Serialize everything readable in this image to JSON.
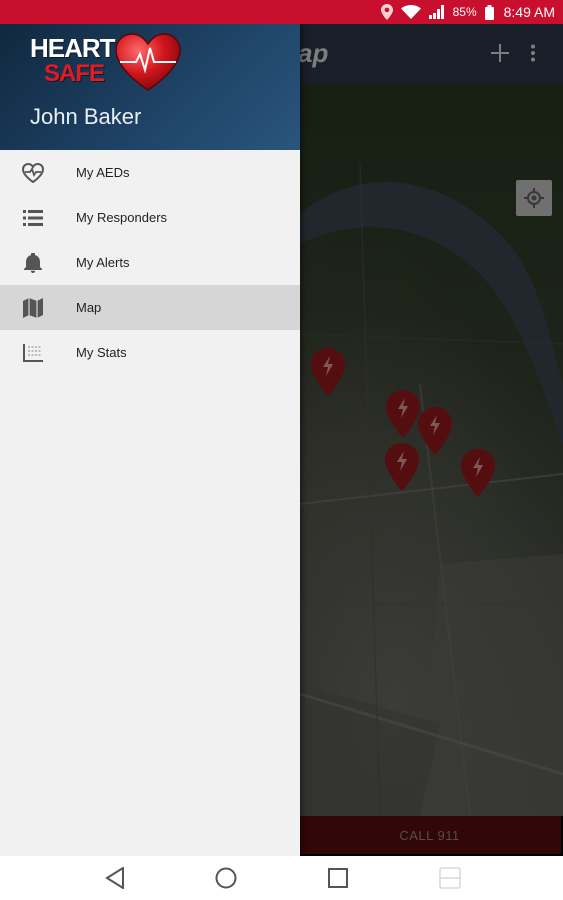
{
  "status_bar": {
    "battery_percent": "85%",
    "time": "8:49 AM"
  },
  "app_bar": {
    "title": "Map",
    "visible_title_fragment": "ap"
  },
  "drawer": {
    "logo_text_top": "HEART",
    "logo_text_bottom": "SAFE",
    "user_name": "John Baker",
    "items": [
      {
        "label": "My AEDs",
        "icon": "heart-pulse-icon"
      },
      {
        "label": "My Responders",
        "icon": "list-icon"
      },
      {
        "label": "My Alerts",
        "icon": "bell-icon"
      },
      {
        "label": "Map",
        "icon": "map-icon",
        "active": true
      },
      {
        "label": "My Stats",
        "icon": "stats-table-icon"
      }
    ]
  },
  "map": {
    "pins": 5
  },
  "call_button": {
    "label": "CALL 911"
  },
  "colors": {
    "status_bar": "#c8102e",
    "app_bar": "#2c3a49",
    "drawer_header": "#1f4468",
    "pin": "#9b1b1e",
    "call_bar": "#5a0d0d"
  }
}
